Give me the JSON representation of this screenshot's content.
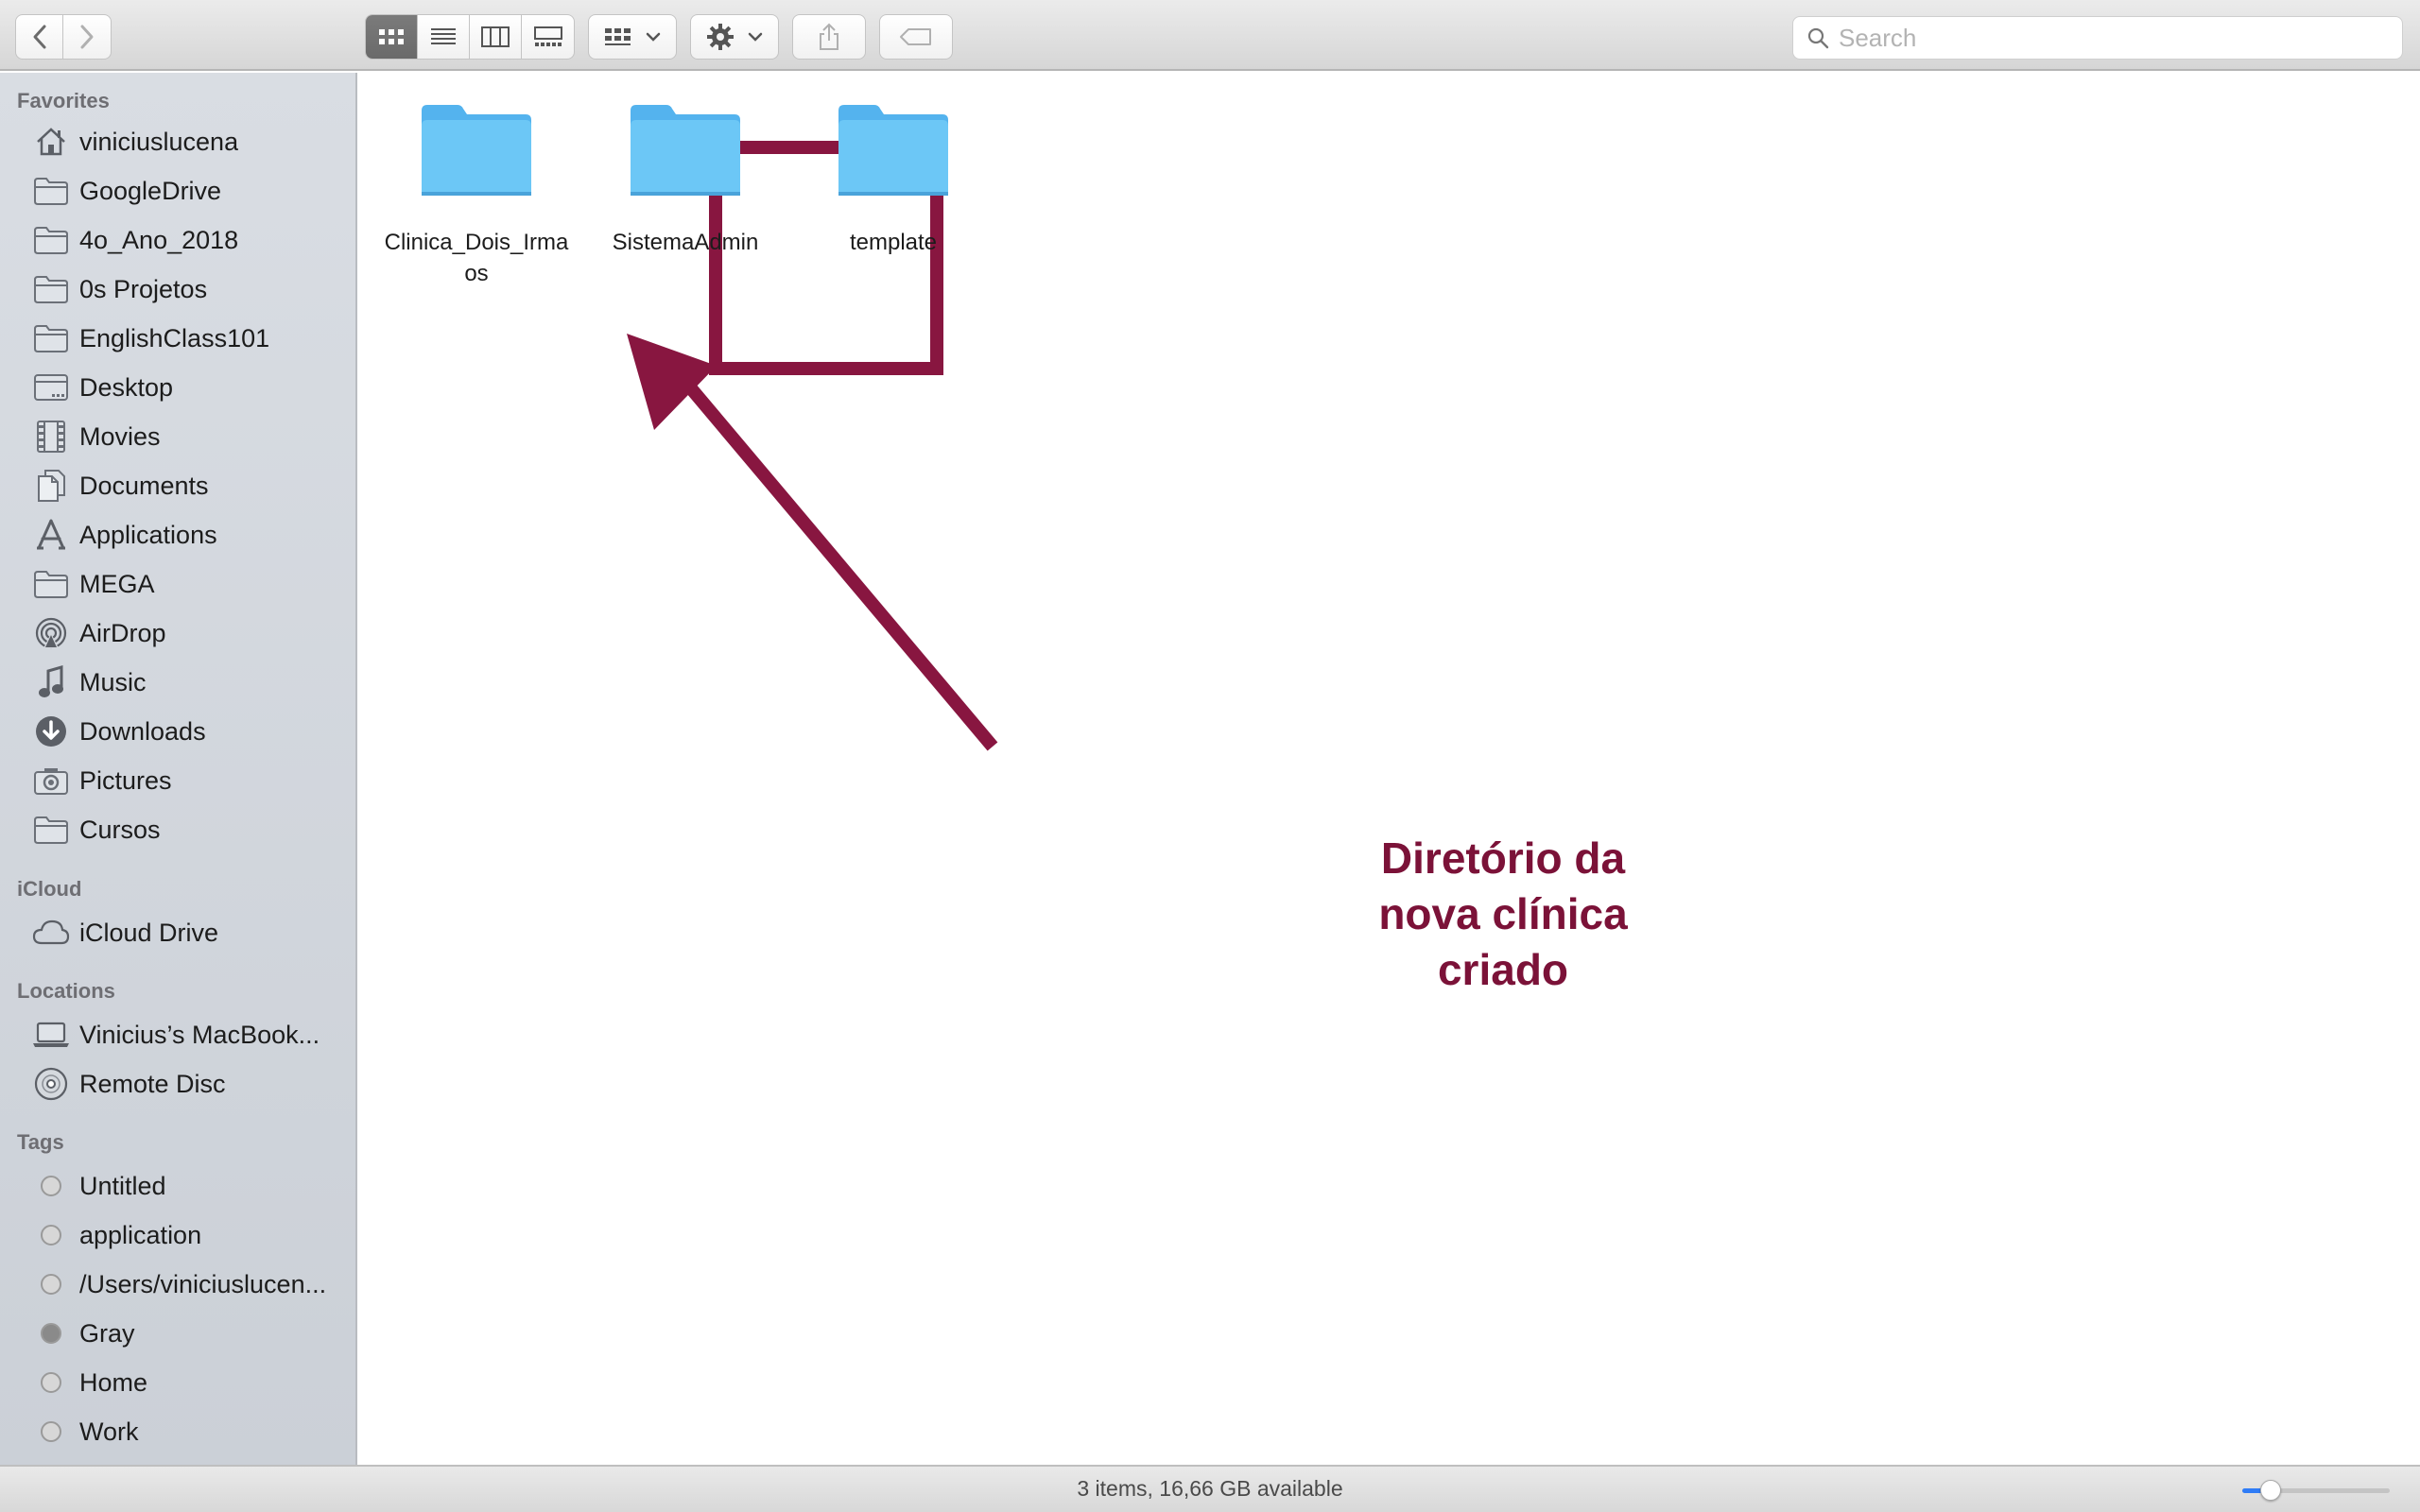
{
  "toolbar": {
    "back_icon": "chevron-left-icon",
    "forward_icon": "chevron-right-icon",
    "view_modes": [
      "icon-view",
      "list-view",
      "column-view",
      "gallery-view"
    ],
    "active_view": "icon-view",
    "search_placeholder": "Search"
  },
  "sidebar": {
    "favorites_title": "Favorites",
    "favorites": [
      {
        "label": "viniciuslucena",
        "icon": "home-icon"
      },
      {
        "label": "GoogleDrive",
        "icon": "folder-icon"
      },
      {
        "label": "4o_Ano_2018",
        "icon": "folder-icon"
      },
      {
        "label": "0s Projetos",
        "icon": "folder-icon"
      },
      {
        "label": "EnglishClass101",
        "icon": "folder-icon"
      },
      {
        "label": "Desktop",
        "icon": "desktop-icon"
      },
      {
        "label": "Movies",
        "icon": "film-icon"
      },
      {
        "label": "Documents",
        "icon": "document-icon"
      },
      {
        "label": "Applications",
        "icon": "applications-icon"
      },
      {
        "label": "MEGA",
        "icon": "folder-icon"
      },
      {
        "label": "AirDrop",
        "icon": "airdrop-icon"
      },
      {
        "label": "Music",
        "icon": "music-note-icon"
      },
      {
        "label": "Downloads",
        "icon": "download-icon"
      },
      {
        "label": "Pictures",
        "icon": "camera-icon"
      },
      {
        "label": "Cursos",
        "icon": "folder-icon"
      }
    ],
    "icloud_title": "iCloud",
    "icloud": [
      {
        "label": "iCloud Drive",
        "icon": "cloud-icon"
      }
    ],
    "locations_title": "Locations",
    "locations": [
      {
        "label": "Vinicius’s MacBook...",
        "icon": "laptop-icon"
      },
      {
        "label": "Remote Disc",
        "icon": "disc-icon"
      }
    ],
    "tags_title": "Tags",
    "tags": [
      {
        "label": "Untitled",
        "color": "#d7d7d7"
      },
      {
        "label": "application",
        "color": "#d7d7d7"
      },
      {
        "label": "/Users/viniciuslucen...",
        "color": "#d7d7d7"
      },
      {
        "label": "Gray",
        "color": "#8a8a8a"
      },
      {
        "label": "Home",
        "color": "#d7d7d7"
      },
      {
        "label": "Work",
        "color": "#d7d7d7"
      }
    ]
  },
  "files": [
    {
      "name": "Clinica_Dois_Irmaos",
      "icon": "folder-icon",
      "highlighted": true
    },
    {
      "name": "SistemaAdmin",
      "icon": "folder-icon",
      "highlighted": false
    },
    {
      "name": "template",
      "icon": "folder-icon",
      "highlighted": false
    }
  ],
  "annotation": {
    "lines": [
      "Diretório da",
      "nova clínica",
      "criado"
    ],
    "color": "#7b1238"
  },
  "status": {
    "text": "3 items, 16,66 GB available"
  },
  "zoom": {
    "level": 0.15
  }
}
